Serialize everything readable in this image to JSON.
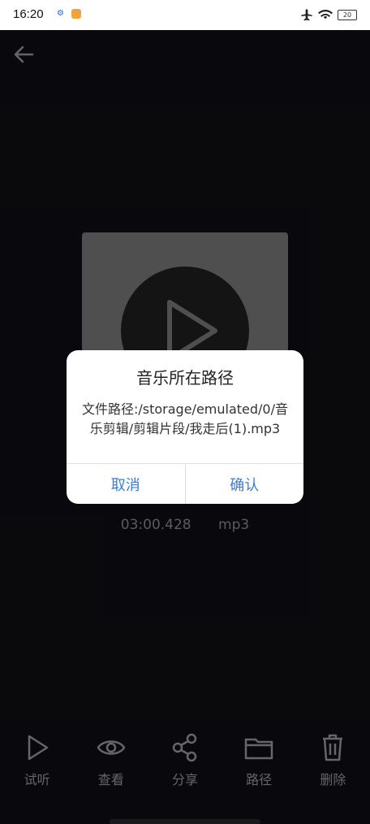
{
  "statusbar": {
    "time": "16:20",
    "battery": "20"
  },
  "media": {
    "duration": "03:00.428",
    "format": "mp3"
  },
  "dialog": {
    "title": "音乐所在路径",
    "message": "文件路径:/storage/emulated/0/音乐剪辑/剪辑片段/我走后(1).mp3",
    "cancel": "取消",
    "confirm": "确认"
  },
  "bottom_nav": {
    "items": [
      {
        "label": "试听",
        "icon": "play-icon"
      },
      {
        "label": "查看",
        "icon": "eye-icon"
      },
      {
        "label": "分享",
        "icon": "share-icon"
      },
      {
        "label": "路径",
        "icon": "folder-icon"
      },
      {
        "label": "删除",
        "icon": "trash-icon"
      }
    ]
  },
  "colors": {
    "background": "#0f0f14",
    "accent": "#3a7ed6"
  }
}
